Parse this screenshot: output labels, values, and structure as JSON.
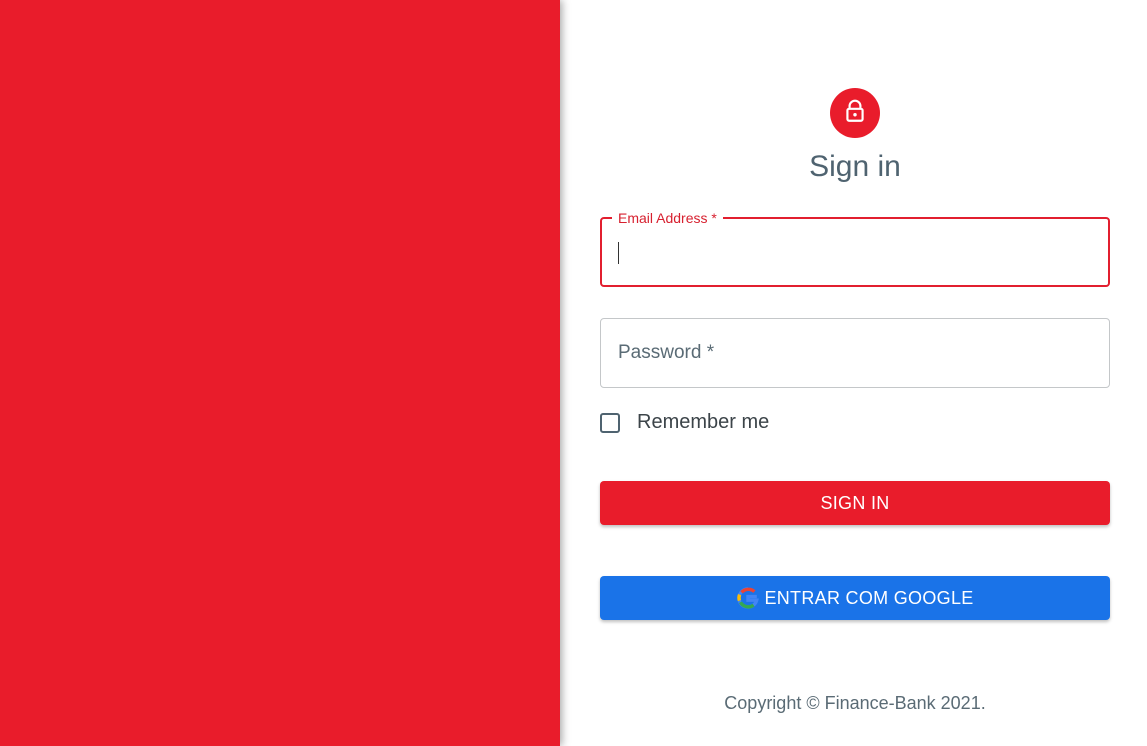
{
  "form": {
    "title": "Sign in",
    "lock_icon": "lock-icon",
    "email": {
      "label": "Email Address *",
      "value": ""
    },
    "password": {
      "label": "Password *",
      "value": ""
    },
    "remember_label": "Remember me",
    "remember_checked": false,
    "signin_label": "SIGN IN",
    "google_label": "ENTRAR COM GOOGLE",
    "google_icon": "google-icon"
  },
  "footer": {
    "copyright": "Copyright © Finance-Bank 2021."
  },
  "colors": {
    "brand_red": "#e91c2b",
    "google_blue": "#1a73e8",
    "text_muted": "#4f6370"
  }
}
